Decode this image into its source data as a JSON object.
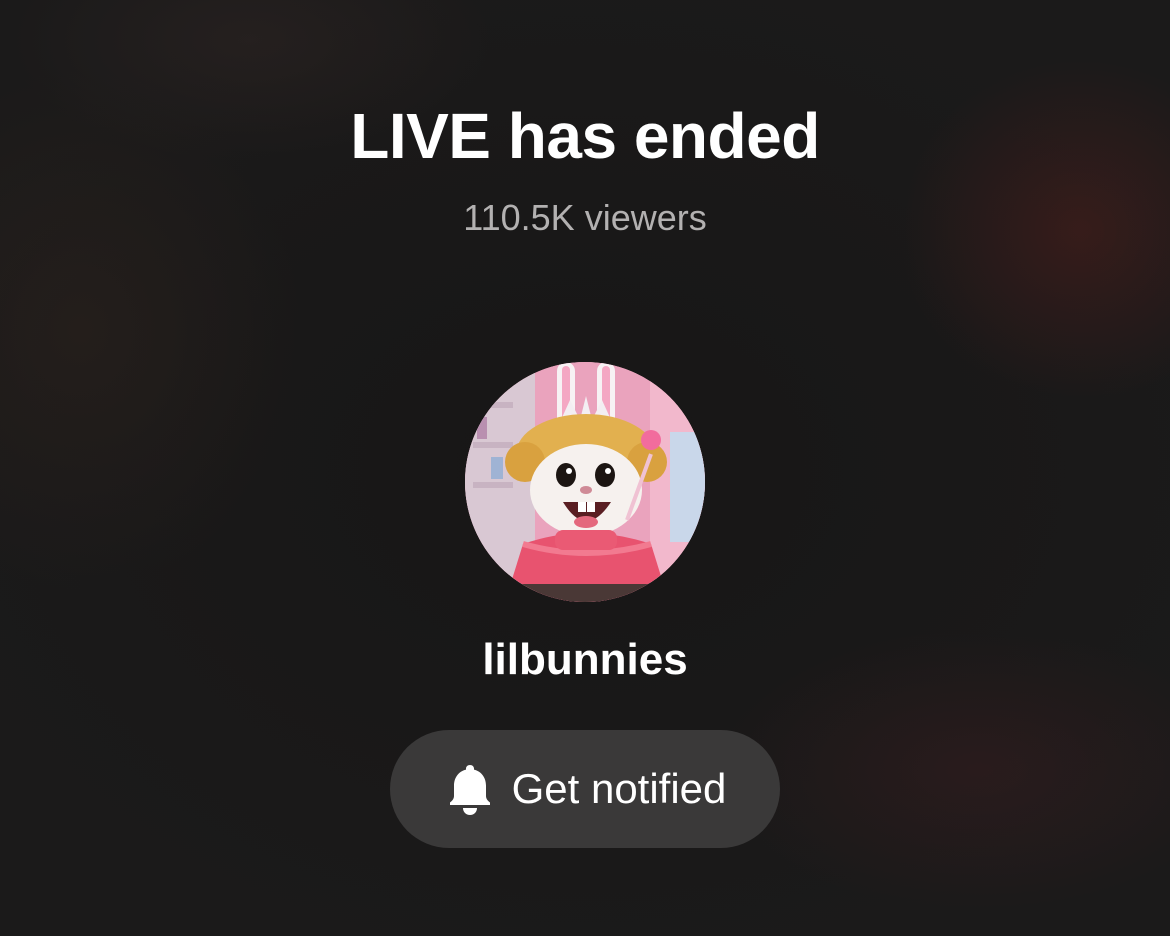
{
  "live": {
    "status_title": "LIVE has ended",
    "viewers_text": "110.5K viewers"
  },
  "host": {
    "username": "lilbunnies",
    "avatar_icon": "host-avatar"
  },
  "actions": {
    "notify_label": "Get notified",
    "notify_icon": "bell-icon"
  },
  "colors": {
    "background": "#1a1919",
    "button_background": "#3a3939",
    "primary_text": "#ffffff",
    "secondary_text": "#b3b1b1"
  }
}
